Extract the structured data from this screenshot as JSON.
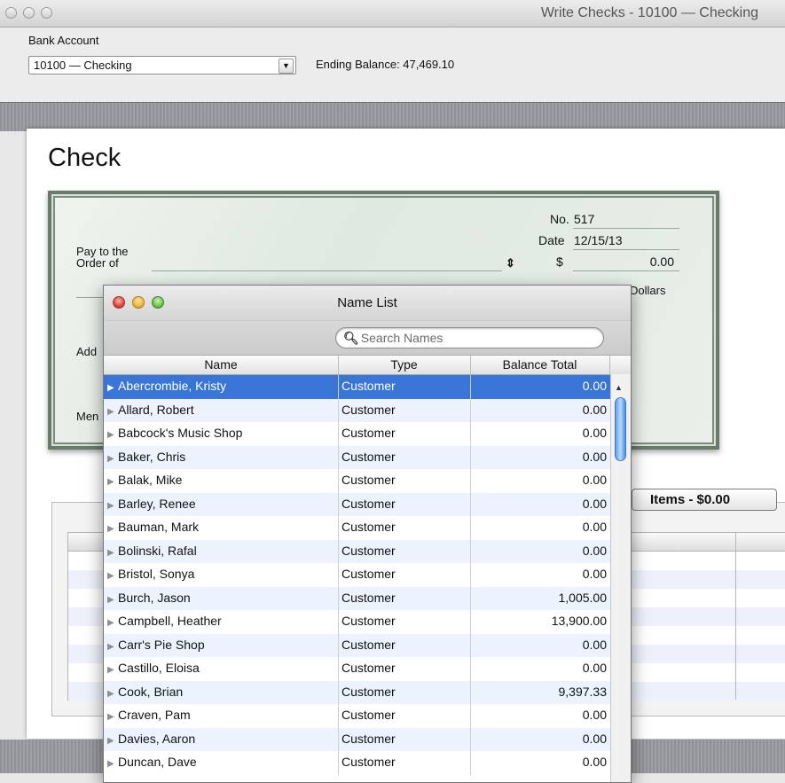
{
  "window": {
    "title": "Write Checks - 10100 — Checking"
  },
  "toolbar": {
    "bank_account_label": "Bank Account",
    "account_value": "10100 — Checking",
    "ending_balance": "Ending Balance:  47,469.10"
  },
  "check": {
    "heading": "Check",
    "no_label": "No.",
    "no_value": "517",
    "date_label": "Date",
    "date_value": "12/15/13",
    "pay_to_line1": "Pay to the",
    "pay_to_line2": "Order of",
    "payee_value": "",
    "dollar_sign": "$",
    "amount_value": "0.00",
    "dollars_label": "Dollars",
    "address_label": "Add",
    "memo_label": "Men"
  },
  "items_tab": {
    "label": "Items - $0.00"
  },
  "name_list": {
    "title": "Name List",
    "search_placeholder": "Search Names",
    "columns": [
      "Name",
      "Type",
      "Balance Total"
    ],
    "rows": [
      {
        "name": "Abercrombie, Kristy",
        "type": "Customer",
        "balance": "0.00",
        "selected": true
      },
      {
        "name": "Allard, Robert",
        "type": "Customer",
        "balance": "0.00"
      },
      {
        "name": "Babcock's Music Shop",
        "type": "Customer",
        "balance": "0.00"
      },
      {
        "name": "Baker, Chris",
        "type": "Customer",
        "balance": "0.00"
      },
      {
        "name": "Balak, Mike",
        "type": "Customer",
        "balance": "0.00"
      },
      {
        "name": "Barley, Renee",
        "type": "Customer",
        "balance": "0.00"
      },
      {
        "name": "Bauman, Mark",
        "type": "Customer",
        "balance": "0.00"
      },
      {
        "name": "Bolinski, Rafal",
        "type": "Customer",
        "balance": "0.00"
      },
      {
        "name": "Bristol, Sonya",
        "type": "Customer",
        "balance": "0.00"
      },
      {
        "name": "Burch, Jason",
        "type": "Customer",
        "balance": "1,005.00"
      },
      {
        "name": "Campbell, Heather",
        "type": "Customer",
        "balance": "13,900.00"
      },
      {
        "name": "Carr's Pie Shop",
        "type": "Customer",
        "balance": "0.00"
      },
      {
        "name": "Castillo, Eloisa",
        "type": "Customer",
        "balance": "0.00"
      },
      {
        "name": "Cook, Brian",
        "type": "Customer",
        "balance": "9,397.33"
      },
      {
        "name": "Craven, Pam",
        "type": "Customer",
        "balance": "0.00"
      },
      {
        "name": "Davies, Aaron",
        "type": "Customer",
        "balance": "0.00"
      },
      {
        "name": "Duncan, Dave",
        "type": "Customer",
        "balance": "0.00"
      }
    ]
  },
  "colors": {
    "selection": "#3875d7",
    "row_alt": "#edf3fe",
    "check_border": "#6a7a6a"
  }
}
